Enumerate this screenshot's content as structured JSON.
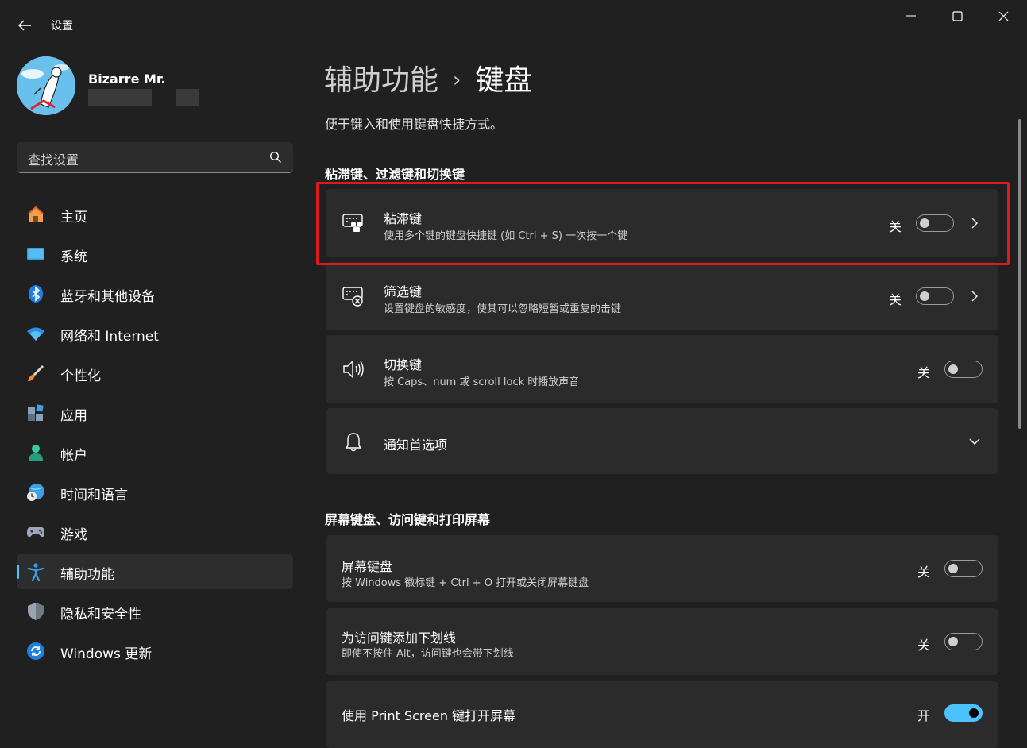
{
  "window": {
    "title": "设置",
    "controls": [
      "minimize-icon",
      "maximize-icon",
      "close-icon"
    ]
  },
  "profile": {
    "name": "Bizarre Mr."
  },
  "search": {
    "placeholder": "查找设置"
  },
  "nav": {
    "items": [
      {
        "label": "主页",
        "icon": "home-icon"
      },
      {
        "label": "系统",
        "icon": "system-icon"
      },
      {
        "label": "蓝牙和其他设备",
        "icon": "bluetooth-icon"
      },
      {
        "label": "网络和 Internet",
        "icon": "wifi-icon"
      },
      {
        "label": "个性化",
        "icon": "brush-icon"
      },
      {
        "label": "应用",
        "icon": "apps-icon"
      },
      {
        "label": "帐户",
        "icon": "account-icon"
      },
      {
        "label": "时间和语言",
        "icon": "globe-clock-icon"
      },
      {
        "label": "游戏",
        "icon": "gamepad-icon"
      },
      {
        "label": "辅助功能",
        "icon": "accessibility-icon",
        "active": true
      },
      {
        "label": "隐私和安全性",
        "icon": "shield-icon"
      },
      {
        "label": "Windows 更新",
        "icon": "update-icon"
      }
    ]
  },
  "breadcrumb": {
    "parent": "辅助功能",
    "separator": "›",
    "current": "键盘"
  },
  "page_desc": "便于键入和使用键盘快捷方式。",
  "sections": [
    {
      "heading": "粘滞键、过滤键和切换键",
      "cards": [
        {
          "title": "粘滞键",
          "subtitle": "使用多个键的键盘快捷键 (如 Ctrl + S) 一次按一个键",
          "state": "关",
          "on": false,
          "icon": "sticky-keys-icon"
        },
        {
          "title": "筛选键",
          "subtitle": "设置键盘的敏感度，使其可以忽略短暂或重复的击键",
          "state": "关",
          "on": false,
          "icon": "filter-keys-icon"
        },
        {
          "title": "切换键",
          "subtitle": "按 Caps、num 或 scroll lock 时播放声音",
          "state": "关",
          "on": false,
          "icon": "speaker-icon"
        },
        {
          "title": "通知首选项",
          "icon": "bell-icon"
        }
      ]
    },
    {
      "heading": "屏幕键盘、访问键和打印屏幕",
      "cards": [
        {
          "title": "屏幕键盘",
          "subtitle": "按 Windows 徽标键 + Ctrl + O 打开或关闭屏幕键盘",
          "state": "关",
          "on": false
        },
        {
          "title": "为访问键添加下划线",
          "subtitle": "即使不按住 Alt，访问键也会带下划线",
          "state": "关",
          "on": false
        },
        {
          "title": "使用 Print Screen 键打开屏幕",
          "state": "开",
          "on": true
        }
      ]
    }
  ],
  "colors": {
    "background": "#202020",
    "card": "#2b2b2b",
    "accent": "#4cc2ff",
    "highlight": "#e0191f"
  }
}
